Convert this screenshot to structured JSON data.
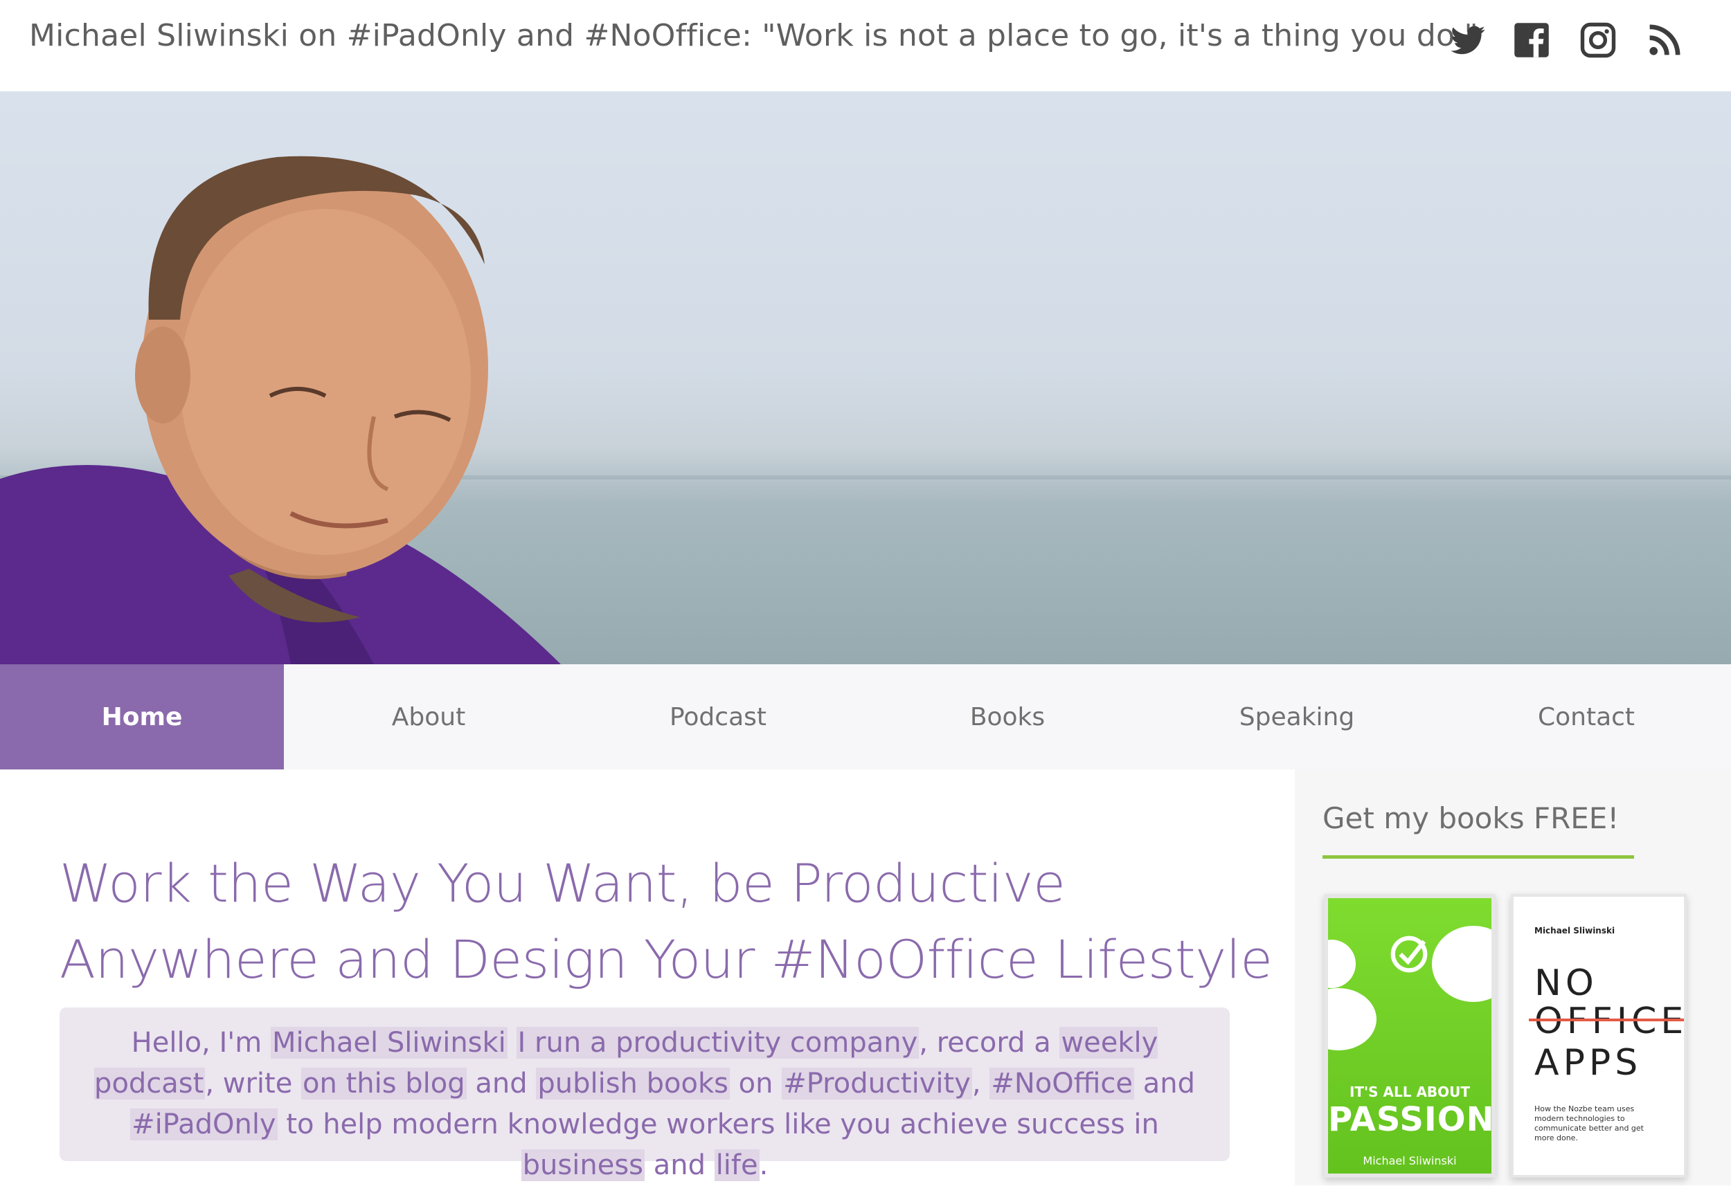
{
  "header": {
    "tagline": "Michael Sliwinski on #iPadOnly and #NoOffice: \"Work is not a place to go, it's a thing you do.\"",
    "social": [
      "twitter-icon",
      "facebook-icon",
      "instagram-icon",
      "rss-icon"
    ]
  },
  "nav": {
    "items": [
      {
        "label": "Home",
        "active": true
      },
      {
        "label": "About"
      },
      {
        "label": "Podcast"
      },
      {
        "label": "Books"
      },
      {
        "label": "Speaking"
      },
      {
        "label": "Contact"
      }
    ]
  },
  "main": {
    "headline_line1": "Work the Way You Want, be Productive",
    "headline_line2": "Anywhere and Design Your #NoOffice Lifestyle",
    "intro": {
      "p1": "Hello, I'm ",
      "link_name": "Michael Sliwinski",
      "p2": " ",
      "link_company": "I run a productivity company",
      "p3": ", record a ",
      "link_podcast": "weekly podcast",
      "p4": ", write ",
      "link_blog": "on this blog",
      "p5": " and ",
      "link_books": "publish books",
      "p6": " on ",
      "link_productivity": "#Productivity",
      "p7": ", ",
      "link_nooffice": "#NoOffice",
      "p8": " and ",
      "link_ipadonly": "#iPadOnly",
      "p9": " to help modern knowledge workers like you achieve success in ",
      "link_business": "business",
      "p10": " and ",
      "link_life": "life",
      "p11": "."
    }
  },
  "sidebar": {
    "title": "Get my books FREE!",
    "book1": {
      "subtitle": "IT'S ALL ABOUT",
      "title": "PASSION",
      "author": "Michael Sliwinski"
    },
    "book2": {
      "author": "Michael Sliwinski",
      "line1": "NO",
      "line2": "OFFICE",
      "line3": "APPS",
      "blurb": "How the Nozbe team uses modern technologies to communicate better and get more done."
    }
  },
  "colors": {
    "accent": "#8a6aac",
    "nav_bg": "#f7f7f9",
    "green_rule": "#8dc63f",
    "intro_bg": "#ece6ef"
  }
}
